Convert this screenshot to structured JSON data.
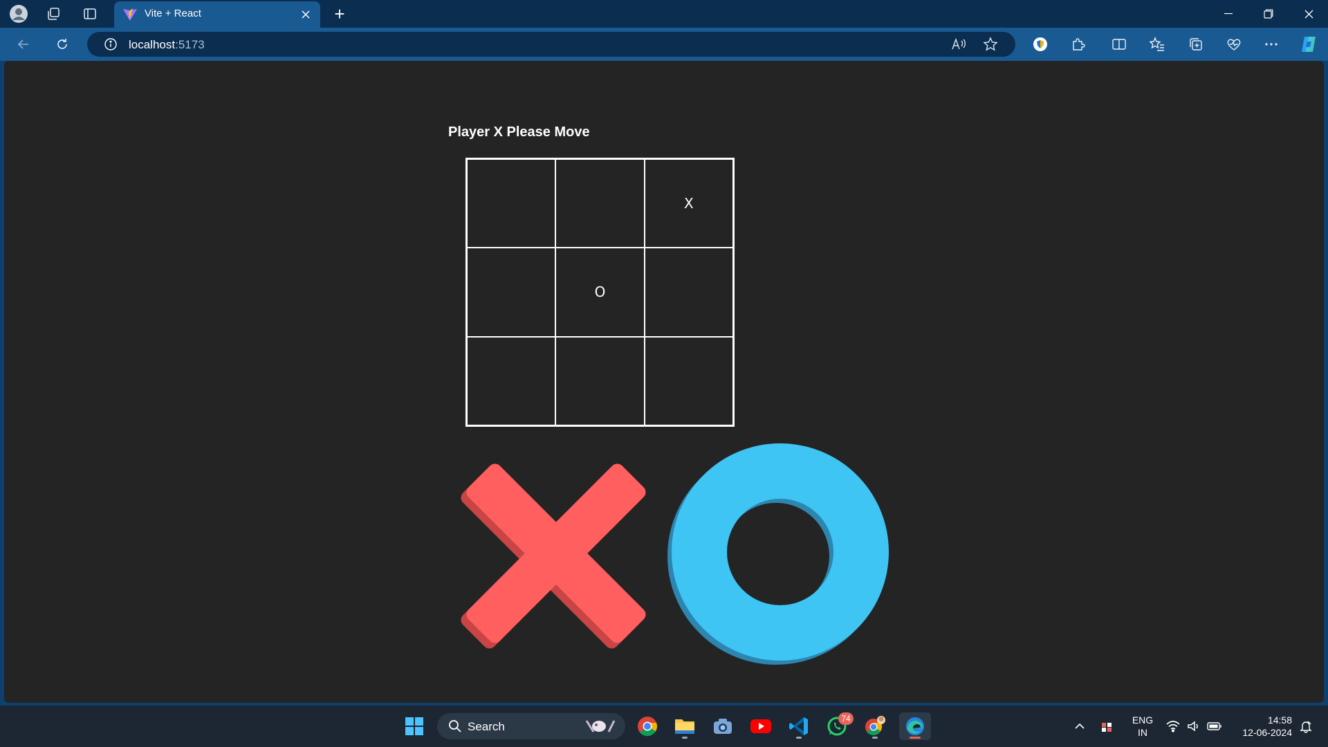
{
  "browser": {
    "tab": {
      "title": "Vite + React"
    },
    "address": {
      "host": "localhost",
      "port": ":5173"
    }
  },
  "game": {
    "status": "Player X Please Move",
    "board": [
      "",
      "",
      "X",
      "",
      "O",
      "",
      "",
      "",
      ""
    ]
  },
  "taskbar": {
    "search_label": "Search",
    "whatsapp_badge": "74",
    "language_line1": "ENG",
    "language_line2": "IN",
    "time": "14:58",
    "date": "12-06-2024"
  },
  "colors": {
    "logo_x": "#ff5f5f",
    "logo_o": "#3ec5f4",
    "page_bg": "#242424",
    "browser_accent": "#1a5a92"
  }
}
